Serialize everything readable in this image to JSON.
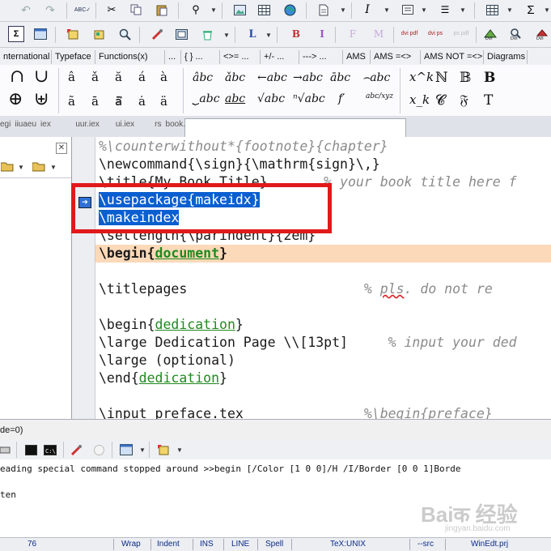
{
  "symbol_tabs": [
    "nternational",
    "Typeface",
    "Functions(x)",
    "...",
    "{ } ...",
    "<>= ...",
    "+/- ...",
    "---> ...",
    "AMS",
    "AMS =<>",
    "AMS NOT =<>",
    "Diagrams"
  ],
  "symbols": {
    "row1": [
      "∩",
      "∪",
      "â",
      "ǎ",
      "ă",
      "á",
      "à",
      "âbc",
      "ǎbc",
      "←abc",
      "→abc",
      "ābc",
      "⌢abc",
      "x^k",
      "ℕ",
      "𝔹",
      "B"
    ],
    "row2": [
      "⊕",
      "⊎",
      "ã",
      "ā",
      "ā⃗",
      "ȧ",
      "ä",
      "⏟abc",
      "abc",
      "√abc",
      "ⁿ√abc",
      "f′",
      "abc/xyz",
      "x_k",
      "𝓒",
      "𝔉",
      "T"
    ]
  },
  "toolbar2": {
    "L": "L",
    "B": "B",
    "I": "I",
    "F": "F",
    "M": "M",
    "dvi_pdf": "dvi pdf",
    "dvi_ps": "dvi ps",
    "ps_pdf": "ps pdf"
  },
  "doc_tab_text": "egi iiuaeu iex       uur.iex    ui.iex     rs book.tex",
  "editor_lines": [
    {
      "parts": [
        [
          "cmt",
          "%\\counterwithout*{footnote}{chapter}"
        ]
      ]
    },
    {
      "parts": [
        [
          "kw",
          "\\newcommand"
        ],
        [
          "arg",
          "{\\sign}{\\mathrm{sign}\\,}"
        ]
      ]
    },
    {
      "parts": [
        [
          "kw",
          "\\title"
        ],
        [
          "arg",
          "{My Book Title}"
        ],
        [
          "cmt",
          "       % your book title here f"
        ]
      ]
    },
    {
      "parts": [
        [
          "sel",
          "\\usepackage{makeidx}"
        ]
      ]
    },
    {
      "parts": [
        [
          "sel",
          "\\makeindex"
        ]
      ]
    },
    {
      "parts": [
        [
          "kw",
          "\\setlength"
        ],
        [
          "arg",
          "{\\parindent}{2em}"
        ]
      ]
    },
    {
      "parts": [
        [
          "bold",
          "\\begin{"
        ],
        [
          "envb",
          "document"
        ],
        [
          "bold",
          "}"
        ]
      ]
    },
    {
      "parts": []
    },
    {
      "parts": [
        [
          "kw",
          "\\titlepages"
        ],
        [
          "cmt",
          "                      % "
        ],
        [
          "cmtspell",
          "pls"
        ],
        [
          "cmt",
          ". do not re"
        ]
      ]
    },
    {
      "parts": []
    },
    {
      "parts": [
        [
          "kw",
          "\\begin{"
        ],
        [
          "env",
          "dedication"
        ],
        [
          "kw",
          "}"
        ]
      ]
    },
    {
      "parts": [
        [
          "kw",
          "\\large Dedication Page \\\\[13pt]"
        ],
        [
          "cmt",
          "     % input your ded"
        ]
      ]
    },
    {
      "parts": [
        [
          "kw",
          "\\large (optional)"
        ]
      ]
    },
    {
      "parts": [
        [
          "kw",
          "\\end{"
        ],
        [
          "env",
          "dedication"
        ],
        [
          "kw",
          "}"
        ]
      ]
    },
    {
      "parts": []
    },
    {
      "parts": [
        [
          "kw",
          "\\input preface.tex"
        ],
        [
          "cmt",
          "               %\\begin{preface}"
        ]
      ]
    }
  ],
  "mode_text": "de=0)",
  "output_lines": [
    "eading special command stopped around >>begin [/Color [1 0 0]/H /I/Border [0 0 1]Borde",
    "",
    "ten"
  ],
  "watermark": "Baiक 经验",
  "watermark_url": "jingyan.baidu.com",
  "statusbar": {
    "line": "76",
    "wrap": "Wrap",
    "indent": "Indent",
    "ins": "INS",
    "linemode": "LINE",
    "spell": "Spell",
    "format": "TeX:UNIX",
    "src": "--src",
    "project": "WinEdt.prj"
  },
  "colors": {
    "selection": "#0a5fd0",
    "current_line": "#fcd9b8",
    "highlight_box": "#e01a1a",
    "env_green": "#1f8a1f",
    "comment_gray": "#8b8b8b"
  }
}
